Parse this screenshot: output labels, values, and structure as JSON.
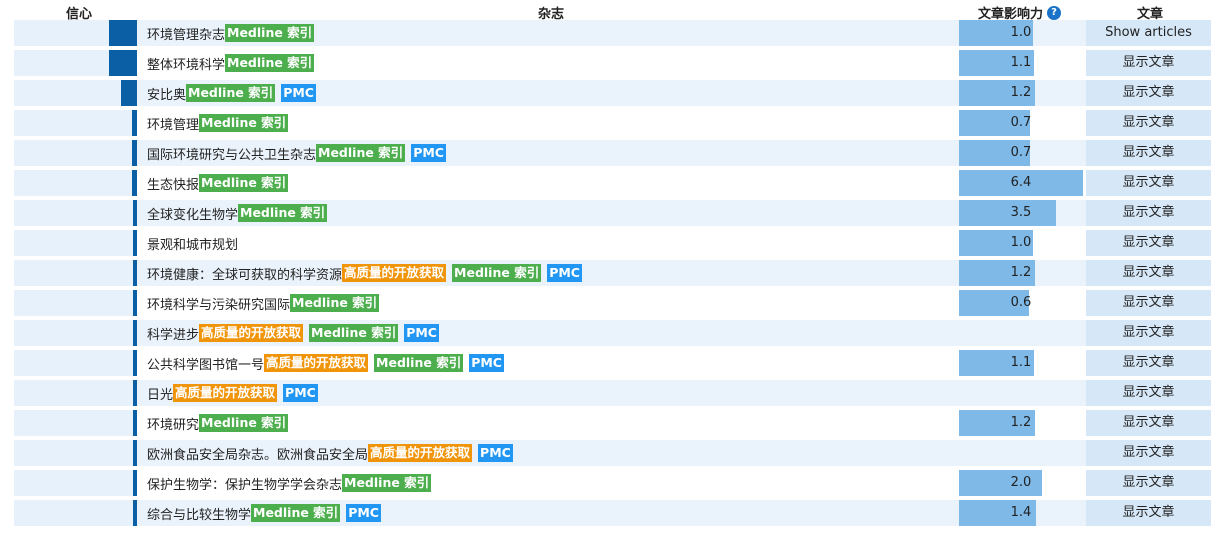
{
  "header": {
    "confidence": "信心",
    "journal": "杂志",
    "impact": "文章影响力",
    "articles": "文章"
  },
  "badges": {
    "medline": "Medline 索引",
    "oa": "高质量的开放获取",
    "pmc": "PMC"
  },
  "rows": [
    {
      "journal": "环境管理杂志",
      "badges": [
        "medline"
      ],
      "impact": "1.0",
      "impact_value": 1.0,
      "confidence": 0.23,
      "button": "Show articles"
    },
    {
      "journal": "整体环境科学",
      "badges": [
        "medline"
      ],
      "impact": "1.1",
      "impact_value": 1.1,
      "confidence": 0.23,
      "button": "显示文章"
    },
    {
      "journal": "安比奥",
      "badges": [
        "medline",
        "pmc"
      ],
      "impact": "1.2",
      "impact_value": 1.2,
      "confidence": 0.13,
      "button": "显示文章"
    },
    {
      "journal": "环境管理",
      "badges": [
        "medline"
      ],
      "impact": "0.7",
      "impact_value": 0.7,
      "confidence": 0.04,
      "button": "显示文章"
    },
    {
      "journal": "国际环境研究与公共卫生杂志",
      "badges": [
        "medline",
        "pmc"
      ],
      "impact": "0.7",
      "impact_value": 0.7,
      "confidence": 0.04,
      "button": "显示文章"
    },
    {
      "journal": "生态快报",
      "badges": [
        "medline"
      ],
      "impact": "6.4",
      "impact_value": 6.4,
      "confidence": 0.04,
      "button": "显示文章"
    },
    {
      "journal": "全球变化生物学",
      "badges": [
        "medline"
      ],
      "impact": "3.5",
      "impact_value": 3.5,
      "confidence": 0.03,
      "button": "显示文章"
    },
    {
      "journal": "景观和城市规划",
      "badges": [],
      "impact": "1.0",
      "impact_value": 1.0,
      "confidence": 0.03,
      "button": "显示文章"
    },
    {
      "journal": "环境健康：全球可获取的科学资源",
      "badges": [
        "oa",
        "medline",
        "pmc"
      ],
      "impact": "1.2",
      "impact_value": 1.2,
      "confidence": 0.03,
      "button": "显示文章"
    },
    {
      "journal": "环境科学与污染研究国际",
      "badges": [
        "medline"
      ],
      "impact": "0.6",
      "impact_value": 0.6,
      "confidence": 0.03,
      "button": "显示文章"
    },
    {
      "journal": "科学进步",
      "badges": [
        "oa",
        "medline",
        "pmc"
      ],
      "impact": "",
      "impact_value": null,
      "confidence": 0.03,
      "button": "显示文章"
    },
    {
      "journal": "公共科学图书馆一号",
      "badges": [
        "oa",
        "medline",
        "pmc"
      ],
      "impact": "1.1",
      "impact_value": 1.1,
      "confidence": 0.03,
      "button": "显示文章"
    },
    {
      "journal": "日光",
      "badges": [
        "oa",
        "pmc"
      ],
      "impact": "",
      "impact_value": null,
      "confidence": 0.03,
      "button": "显示文章"
    },
    {
      "journal": "环境研究",
      "badges": [
        "medline"
      ],
      "impact": "1.2",
      "impact_value": 1.2,
      "confidence": 0.03,
      "button": "显示文章"
    },
    {
      "journal": "欧洲食品安全局杂志。欧洲食品安全局",
      "badges": [
        "oa",
        "pmc"
      ],
      "impact": "",
      "impact_value": null,
      "confidence": 0.03,
      "button": "显示文章"
    },
    {
      "journal": "保护生物学：保护生物学学会杂志",
      "badges": [
        "medline"
      ],
      "impact": "2.0",
      "impact_value": 2.0,
      "confidence": 0.03,
      "button": "显示文章"
    },
    {
      "journal": "综合与比较生物学",
      "badges": [
        "medline",
        "pmc"
      ],
      "impact": "1.4",
      "impact_value": 1.4,
      "confidence": 0.03,
      "button": "显示文章"
    }
  ]
}
